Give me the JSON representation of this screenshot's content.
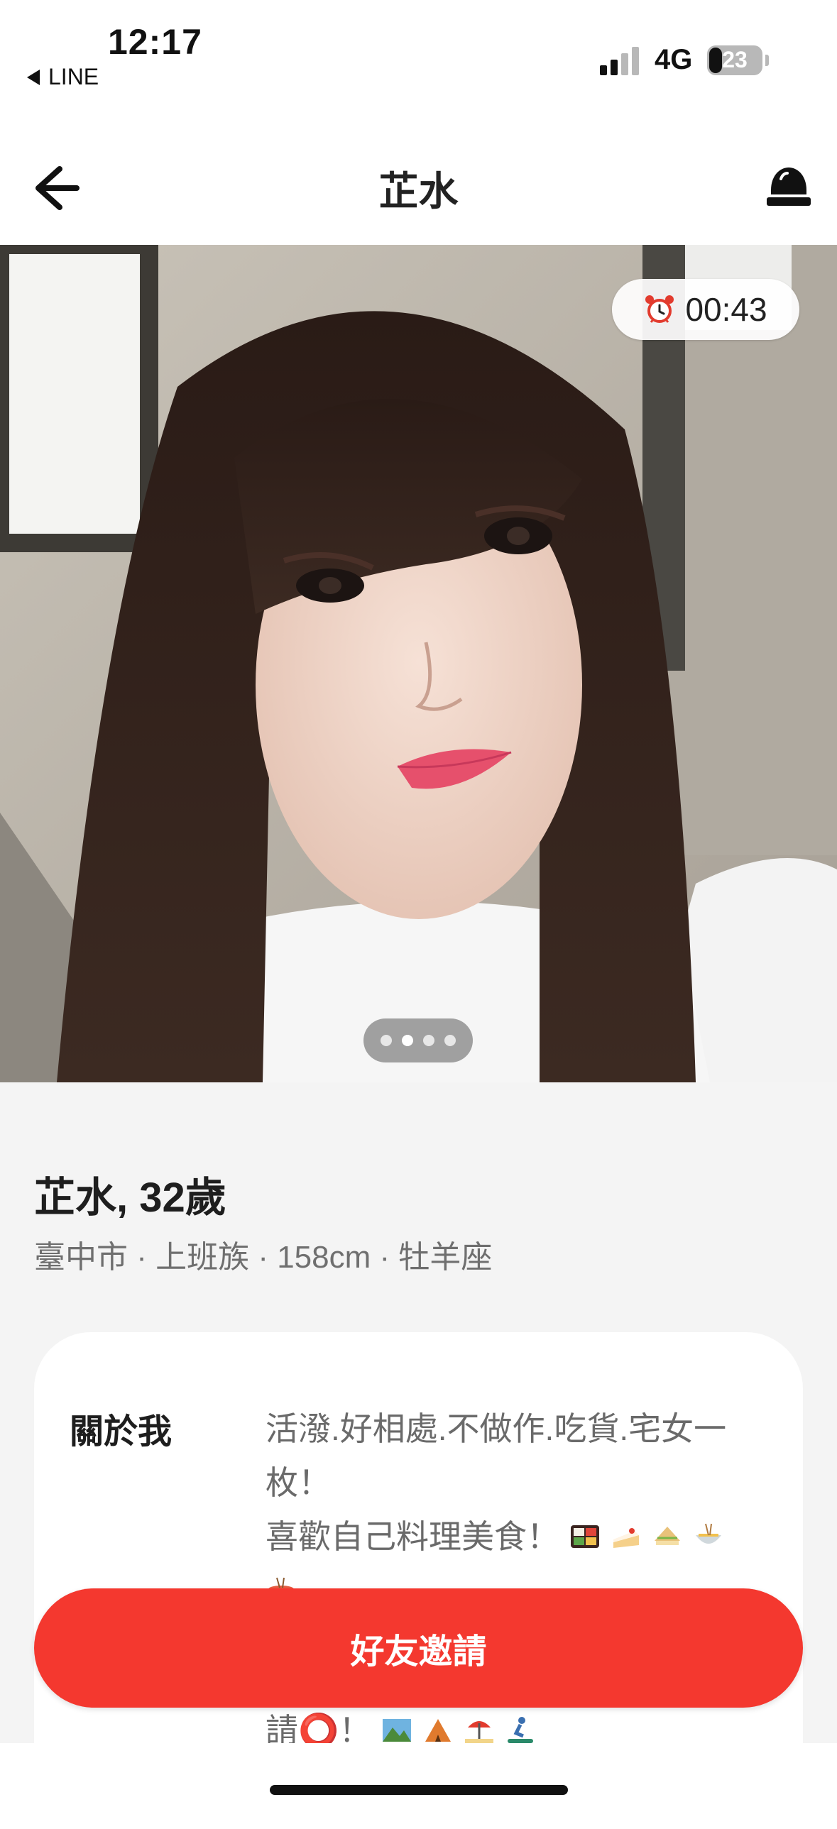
{
  "status_bar": {
    "time": "12:17",
    "back_app": "LINE",
    "network": "4G",
    "battery": "23",
    "battery_level": 0.23,
    "signal_bars": 2,
    "icons": [
      "back-triangle-icon",
      "signal-icon",
      "battery-icon"
    ]
  },
  "header": {
    "title": "芷水",
    "icons": [
      "back-arrow-icon",
      "alarm-bell-icon"
    ]
  },
  "photo": {
    "timer": "00:43",
    "timer_icon": "alarm-clock-icon",
    "page_count": 4,
    "active_page": 2
  },
  "profile": {
    "name_age": "芷水, 32歲",
    "meta": "臺中市 · 上班族 · 158cm · 牡羊座"
  },
  "about": {
    "label": "關於我",
    "line1": "活潑.好相處.不做作.吃貨.宅女一枚！",
    "line2": "喜歡自己料理美食！",
    "line2_icons": [
      "bento-icon",
      "cake-icon",
      "sandwich-icon",
      "noodles-icon"
    ],
    "line3_icons": [
      "hotpot-icon"
    ],
    "partial_text": "請⭕！",
    "partial_icons": [
      "landscape-icon",
      "camping-icon",
      "beach-icon",
      "snowboard-icon"
    ]
  },
  "cta": {
    "label": "好友邀請"
  },
  "colors": {
    "accent": "#f4382f",
    "background": "#f4f4f4",
    "text_primary": "#1e1e1e",
    "text_secondary": "#6f6f6f"
  }
}
